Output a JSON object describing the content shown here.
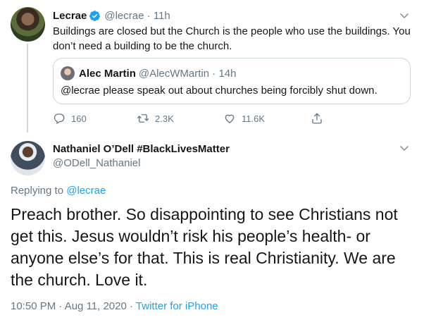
{
  "parent_tweet": {
    "author_name": "Lecrae",
    "author_handle": "@lecrae",
    "time_ago": "11h",
    "text": "Buildings are closed but the Church is the people who use the buildings. You don’t need a building to be the church.",
    "quoted": {
      "author_name": "Alec Martin",
      "author_handle": "@AlecWMartin",
      "time_ago": "14h",
      "text": "@lecrae please speak out about churches being forcibly shut down."
    },
    "actions": {
      "replies": "160",
      "retweets": "2.3K",
      "likes": "11.6K"
    }
  },
  "reply_tweet": {
    "author_name": "Nathaniel O’Dell #BlackLivesMatter",
    "author_handle": "@ODell_Nathaniel",
    "replying_prefix": "Replying to",
    "replying_to": "@lecrae",
    "text": "Preach brother. So disappointing to see Christians not get this. Jesus wouldn’t risk his people’s health- or anyone else’s for that. This is real Christianity. We are the church. Love it.",
    "timestamp": "10:50 PM · Aug 11, 2020",
    "source": "Twitter for iPhone"
  },
  "colors": {
    "text": "#14171a",
    "secondary": "#657786",
    "accent": "#1da1f2",
    "border": "#ccd6dd"
  },
  "icons": {
    "verified": "verified-badge-icon",
    "caret": "chevron-down-icon",
    "reply": "reply-icon",
    "retweet": "retweet-icon",
    "like": "heart-icon",
    "share": "share-icon"
  }
}
